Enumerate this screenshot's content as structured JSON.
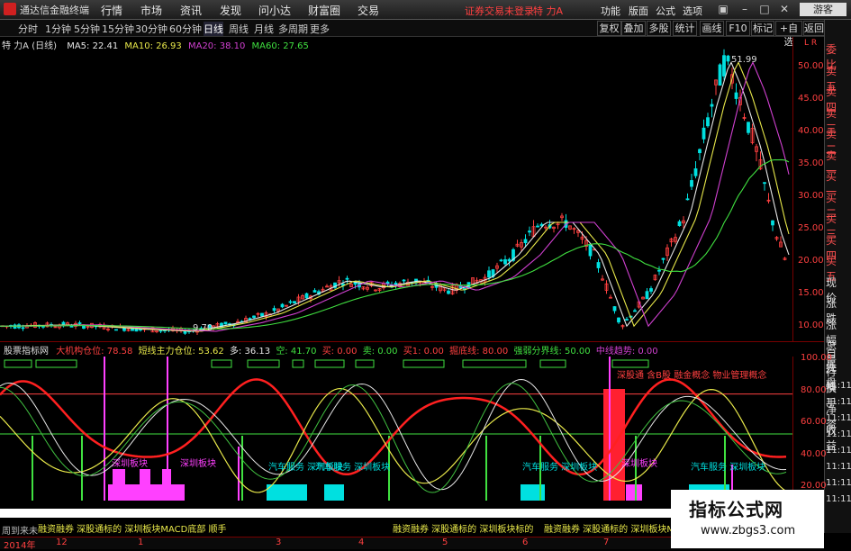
{
  "app": {
    "title": "通达信金融终端"
  },
  "menu": [
    "行情",
    "市场",
    "资讯",
    "发现",
    "问小达",
    "财富圈",
    "交易"
  ],
  "status": {
    "login_warning": "证券交易未登录",
    "stock_name": "特 力A"
  },
  "right_menu": [
    "功能",
    "版面",
    "公式",
    "选项"
  ],
  "guest_label": "游客",
  "periods": [
    "分时",
    "1分钟",
    "5分钟",
    "15分钟",
    "30分钟",
    "60分钟",
    "日线",
    "周线",
    "月线",
    "多周期",
    "更多"
  ],
  "selected_period": "日线",
  "tools": [
    "复权",
    "叠加",
    "多股",
    "统计",
    "画线",
    "F10",
    "标记",
    "+自选",
    "返回"
  ],
  "chart": {
    "title": "特 力A (日线)",
    "ma": [
      {
        "label": "MA5: 22.41",
        "color": "#e6e6e6"
      },
      {
        "label": "MA10: 26.93",
        "color": "#e8e84a"
      },
      {
        "label": "MA20: 38.10",
        "color": "#d040d0"
      },
      {
        "label": "MA60: 27.65",
        "color": "#40e040"
      }
    ],
    "y_ticks": [
      "50.00",
      "45.00",
      "40.00",
      "35.00",
      "30.00",
      "25.00",
      "20.00",
      "15.00",
      "10.00"
    ],
    "high_label": "51.99",
    "low_label": "9.70",
    "axis_corner": "L R"
  },
  "right_panel": [
    "委比",
    "卖五",
    "卖四",
    "卖三",
    "卖二",
    "卖一",
    "买一",
    "买二",
    "买三",
    "买四",
    "买五",
    "现价",
    "涨跌",
    "涨幅",
    "总量",
    "外盘",
    "换手",
    "净资",
    "收益",
    "自选",
    "行情"
  ],
  "indicator": {
    "name": "股票指标网",
    "values": [
      {
        "label": "大机构仓位: 78.58",
        "color": "#ff4040"
      },
      {
        "label": "短线主力仓位: 53.62",
        "color": "#e8e84a"
      },
      {
        "label": "多: 36.13",
        "color": "#e6e6e6"
      },
      {
        "label": "空: 41.70",
        "color": "#40e040"
      },
      {
        "label": "买: 0.00",
        "color": "#ff4040"
      },
      {
        "label": "卖: 0.00",
        "color": "#40e040"
      },
      {
        "label": "买1: 0.00",
        "color": "#ff4040"
      },
      {
        "label": "掘底线: 80.00",
        "color": "#ff4040"
      },
      {
        "label": "强弱分界线: 50.00",
        "color": "#40e040"
      },
      {
        "label": "中线趋势: 0.00",
        "color": "#d040d0"
      }
    ],
    "y_ticks": [
      "100.00",
      "80.00",
      "60.00",
      "40.00",
      "20.00"
    ],
    "sector_labels": [
      "深圳板块",
      "深圳板块",
      "汽车服务 深圳板块",
      "汽车服务 深圳板块",
      "汽车服务 深圳板块",
      "深圳板块",
      "汽车服务 深圳板块",
      "深股通 含B股 融金概念 物业管理概念"
    ],
    "times": [
      "11:11",
      "11:11",
      "11:11",
      "11:11",
      "11:11",
      "11:11",
      "11:11",
      "11:11"
    ]
  },
  "bottom": {
    "left_text": "周到来未",
    "rows": [
      "融资融券 深股通标的 深圳板块MACD底部 顺手",
      "融资融券 深股通标的 深圳板块标的",
      "融资融券 深股通标的 深圳板块MA"
    ],
    "x_labels": [
      "2014年",
      "12",
      "1",
      "3",
      "4",
      "5",
      "6",
      "7"
    ]
  },
  "brand": {
    "name": "指标公式网",
    "url": "www.zbgs3.com"
  },
  "colors": {
    "up": "#ff4040",
    "down": "#00e0e0",
    "ma5": "#e6e6e6",
    "ma10": "#e8e84a",
    "ma20": "#d040d0",
    "ma60": "#40e040"
  }
}
